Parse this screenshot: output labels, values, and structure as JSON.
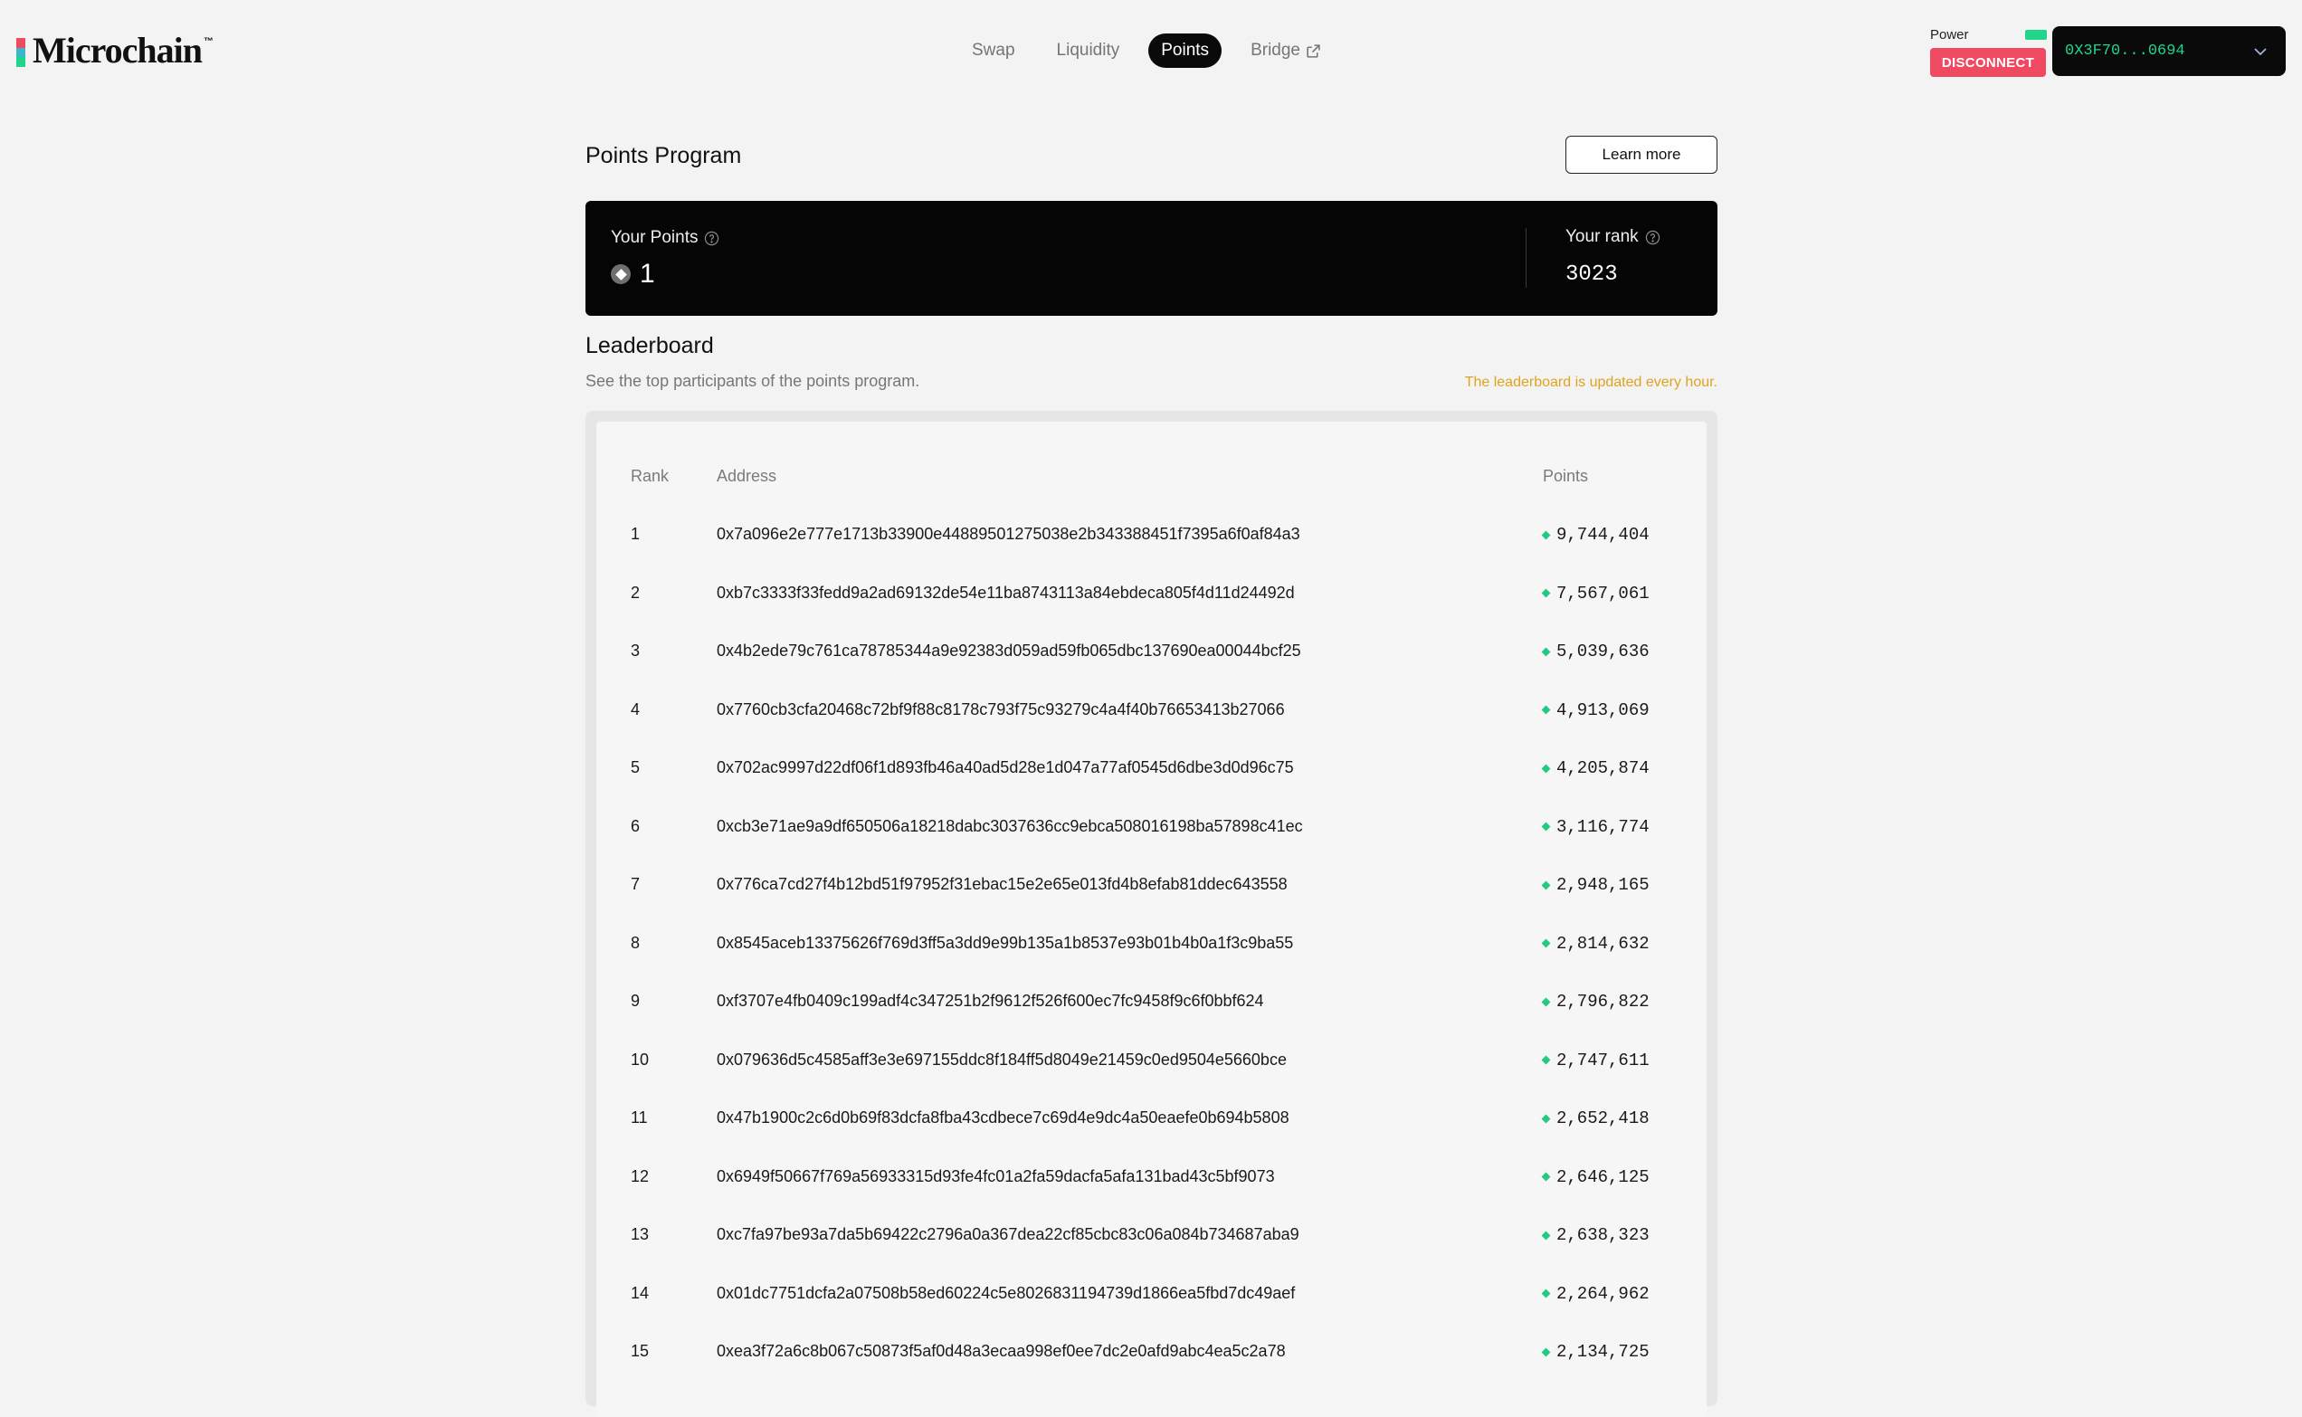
{
  "brand": {
    "name": "Microchain",
    "tm": "™",
    "colors": {
      "red": "#ef4a62",
      "teal": "#3ab7c9",
      "green": "#1fd68b"
    }
  },
  "nav": [
    {
      "label": "Swap",
      "active": false
    },
    {
      "label": "Liquidity",
      "active": false
    },
    {
      "label": "Points",
      "active": true
    },
    {
      "label": "Bridge",
      "active": false,
      "icon": "external-link-icon"
    }
  ],
  "wallet": {
    "power_label": "Power",
    "disconnect_label": "DISCONNECT",
    "address": "0X3F70...0694"
  },
  "points_program": {
    "title": "Points Program",
    "learn_more": "Learn more",
    "your_points_label": "Your Points",
    "your_points": "1",
    "your_rank_label": "Your rank",
    "your_rank": "3023"
  },
  "leaderboard": {
    "title": "Leaderboard",
    "subtitle": "See the top participants of the points program.",
    "note": "The leaderboard is updated every hour.",
    "columns": {
      "rank": "Rank",
      "address": "Address",
      "points": "Points"
    },
    "rows": [
      {
        "rank": "1",
        "address": "0x7a096e2e777e1713b33900e44889501275038e2b343388451f7395a6f0af84a3",
        "points": "9,744,404"
      },
      {
        "rank": "2",
        "address": "0xb7c3333f33fedd9a2ad69132de54e11ba8743113a84ebdeca805f4d11d24492d",
        "points": "7,567,061"
      },
      {
        "rank": "3",
        "address": "0x4b2ede79c761ca78785344a9e92383d059ad59fb065dbc137690ea00044bcf25",
        "points": "5,039,636"
      },
      {
        "rank": "4",
        "address": "0x7760cb3cfa20468c72bf9f88c8178c793f75c93279c4a4f40b76653413b27066",
        "points": "4,913,069"
      },
      {
        "rank": "5",
        "address": "0x702ac9997d22df06f1d893fb46a40ad5d28e1d047a77af0545d6dbe3d0d96c75",
        "points": "4,205,874"
      },
      {
        "rank": "6",
        "address": "0xcb3e71ae9a9df650506a18218dabc3037636cc9ebca508016198ba57898c41ec",
        "points": "3,116,774"
      },
      {
        "rank": "7",
        "address": "0x776ca7cd27f4b12bd51f97952f31ebac15e2e65e013fd4b8efab81ddec643558",
        "points": "2,948,165"
      },
      {
        "rank": "8",
        "address": "0x8545aceb13375626f769d3ff5a3dd9e99b135a1b8537e93b01b4b0a1f3c9ba55",
        "points": "2,814,632"
      },
      {
        "rank": "9",
        "address": "0xf3707e4fb0409c199adf4c347251b2f9612f526f600ec7fc9458f9c6f0bbf624",
        "points": "2,796,822"
      },
      {
        "rank": "10",
        "address": "0x079636d5c4585aff3e3e697155ddc8f184ff5d8049e21459c0ed9504e5660bce",
        "points": "2,747,611"
      },
      {
        "rank": "11",
        "address": "0x47b1900c2c6d0b69f83dcfa8fba43cdbece7c69d4e9dc4a50eaefe0b694b5808",
        "points": "2,652,418"
      },
      {
        "rank": "12",
        "address": "0x6949f50667f769a56933315d93fe4fc01a2fa59dacfa5afa131bad43c5bf9073",
        "points": "2,646,125"
      },
      {
        "rank": "13",
        "address": "0xc7fa97be93a7da5b69422c2796a0a367dea22cf85cbc83c06a084b734687aba9",
        "points": "2,638,323"
      },
      {
        "rank": "14",
        "address": "0x01dc7751dcfa2a07508b58ed60224c5e8026831194739d1866ea5fbd7dc49aef",
        "points": "2,264,962"
      },
      {
        "rank": "15",
        "address": "0xea3f72a6c8b067c50873f5af0d48a3ecaa998ef0ee7dc2e0afd9abc4ea5c2a78",
        "points": "2,134,725"
      }
    ]
  }
}
